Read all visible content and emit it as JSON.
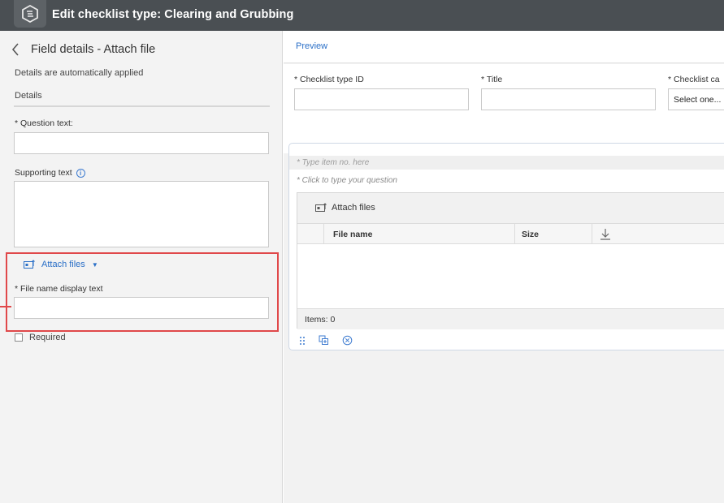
{
  "header": {
    "title": "Edit checklist type: Clearing and Grubbing"
  },
  "left_panel": {
    "title": "Field details - Attach file",
    "auto_note": "Details are automatically applied",
    "details_label": "Details",
    "question_label": "* Question text:",
    "question_value": "",
    "supporting_label": "Supporting text",
    "supporting_value": "",
    "attach_label": "Attach files",
    "file_name_label": "* File name display text",
    "file_name_value": "",
    "required_label": "Required"
  },
  "right_panel": {
    "preview_label": "Preview",
    "fields": {
      "id_label": "* Checklist type ID",
      "title_label": "* Title",
      "category_label": "* Checklist ca",
      "category_value": "Select one..."
    },
    "item_placeholder": "* Type item no. here",
    "question_placeholder": "* Click to type your question",
    "attach_label": "Attach files",
    "table": {
      "columns": [
        "File name",
        "Size"
      ],
      "items_label": "Items: 0"
    }
  },
  "colors": {
    "header_bg": "#4a4f53",
    "accent": "#2a6fc7",
    "highlight": "#e0484a"
  }
}
